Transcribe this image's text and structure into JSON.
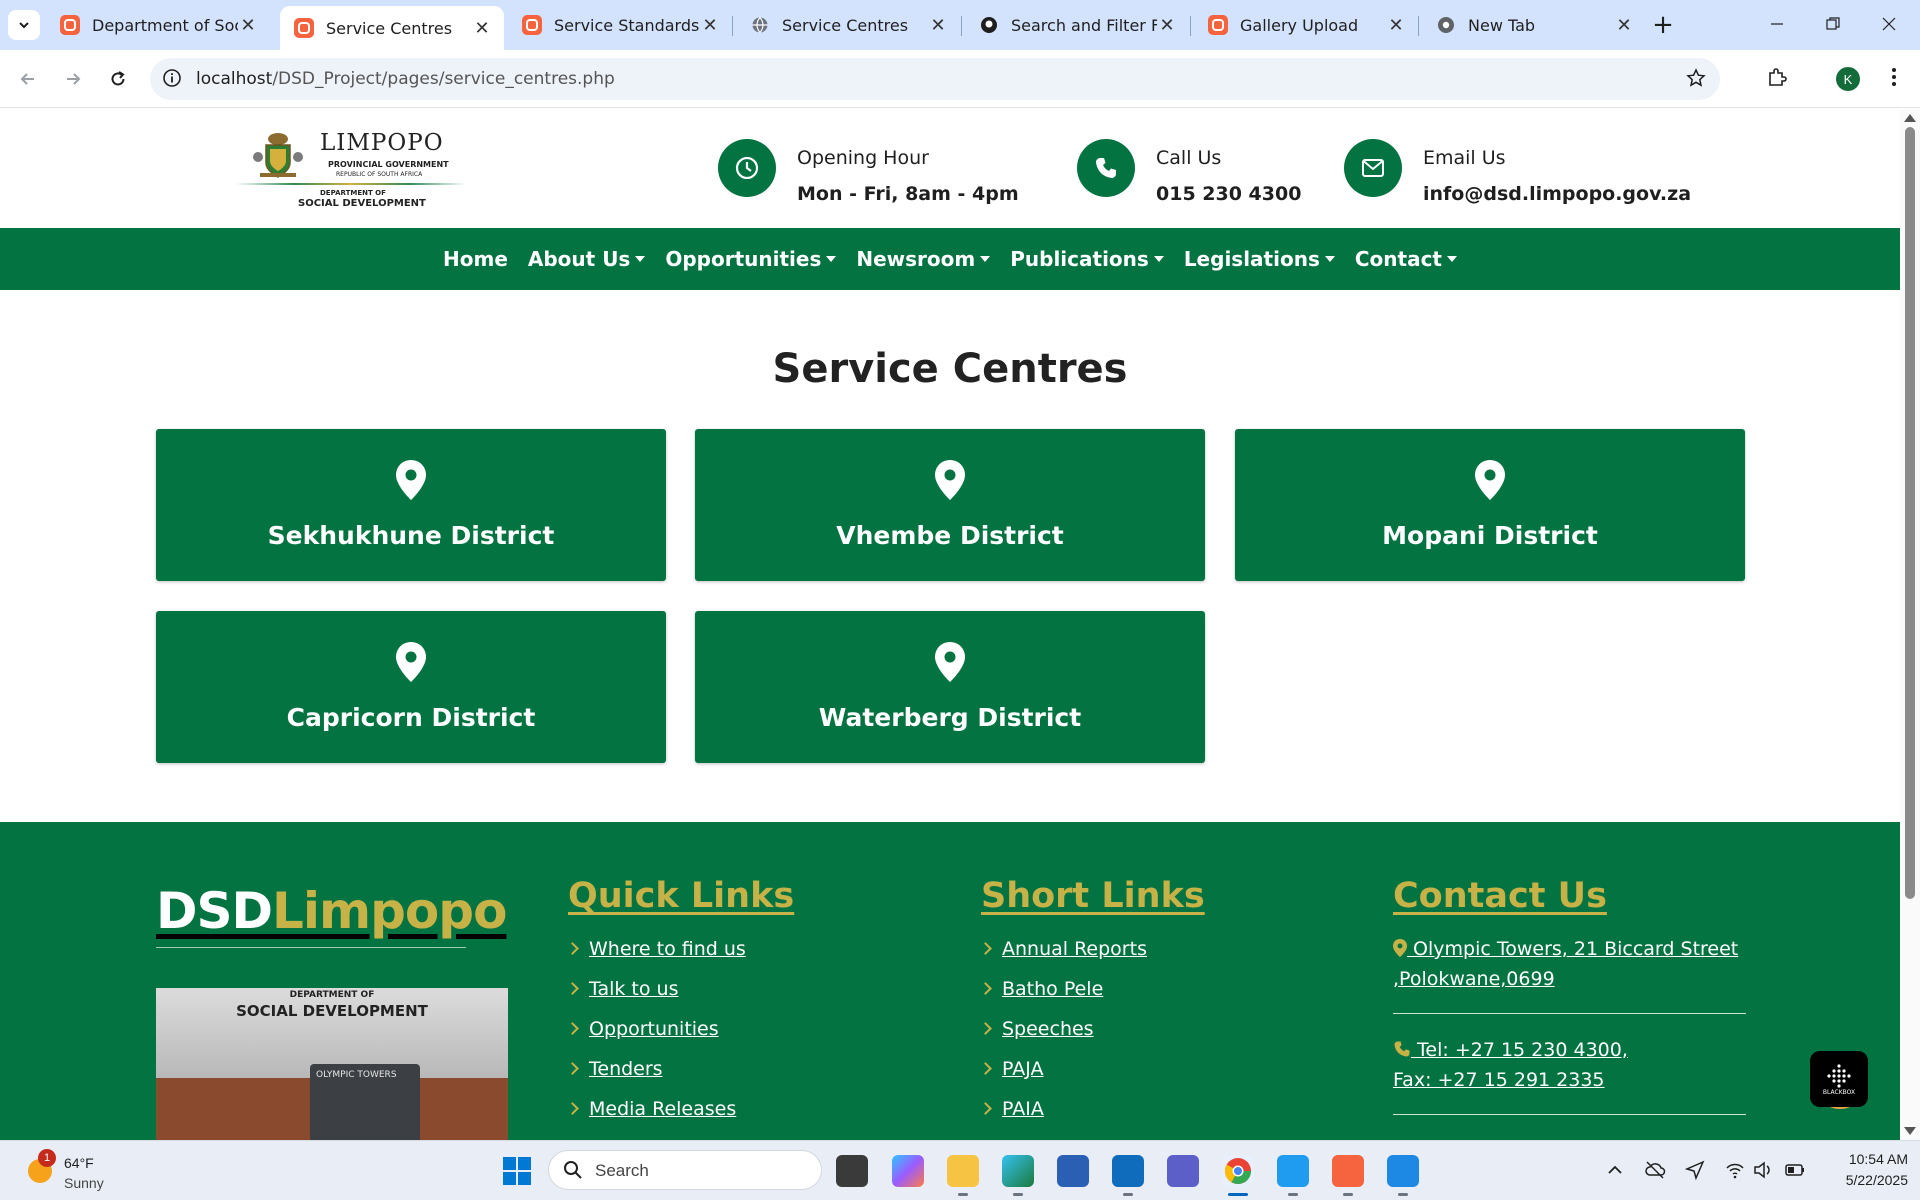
{
  "browser": {
    "tabs": [
      {
        "title": "Department of Social",
        "favicon": "xampp-icon",
        "active": false
      },
      {
        "title": "Service Centres",
        "favicon": "xampp-icon",
        "active": true
      },
      {
        "title": "Service Standards",
        "favicon": "xampp-icon",
        "active": false
      },
      {
        "title": "Service Centres",
        "favicon": "globe-icon",
        "active": false
      },
      {
        "title": "Search and Filter Fun",
        "favicon": "github-icon",
        "active": false
      },
      {
        "title": "Gallery Upload",
        "favicon": "xampp-icon",
        "active": false
      },
      {
        "title": "New Tab",
        "favicon": "chrome-icon",
        "active": false
      }
    ],
    "url_host": "localhost",
    "url_path": "/DSD_Project/pages/service_centres.php",
    "profile_initial": "K"
  },
  "header": {
    "logo": {
      "line1": "LIMPOPO",
      "line2": "PROVINCIAL GOVERNMENT",
      "line3": "REPUBLIC OF SOUTH AFRICA",
      "line4": "DEPARTMENT OF",
      "line5": "SOCIAL DEVELOPMENT"
    },
    "opening": {
      "label": "Opening Hour",
      "value": "Mon - Fri, 8am - 4pm"
    },
    "call": {
      "label": "Call Us",
      "value": "015 230 4300"
    },
    "email": {
      "label": "Email Us",
      "value": "info@dsd.limpopo.gov.za"
    }
  },
  "nav": {
    "home": "Home",
    "about": "About Us",
    "opportunities": "Opportunities",
    "newsroom": "Newsroom",
    "publications": "Publications",
    "legislations": "Legislations",
    "contact": "Contact"
  },
  "main": {
    "title": "Service Centres",
    "districts": [
      "Sekhukhune District",
      "Vhembe District",
      "Mopani District",
      "Capricorn District",
      "Waterberg District"
    ]
  },
  "footer": {
    "brand_a": "DSD",
    "brand_b": "Limpopo",
    "image_text1": "DEPARTMENT OF",
    "image_text2": "SOCIAL DEVELOPMENT",
    "image_text3": "OLYMPIC TOWERS",
    "quick_links": {
      "heading": "Quick Links",
      "items": [
        "Where to find us",
        "Talk to us",
        "Opportunities",
        "Tenders",
        "Media Releases"
      ]
    },
    "short_links": {
      "heading": "Short Links",
      "items": [
        "Annual Reports",
        "Batho Pele",
        "Speeches",
        "PAJA",
        "PAIA"
      ]
    },
    "contact": {
      "heading": "Contact Us",
      "address1": " Olympic Towers, 21 Biccard Street",
      "address2": ",Polokwane,0699",
      "tel": " Tel: +27 15 230 4300,",
      "fax": "Fax: +27 15 291 2335"
    }
  },
  "taskbar": {
    "weather_temp": "64°F",
    "weather_cond": "Sunny",
    "weather_badge": "1",
    "search": "Search",
    "time": "10:54 AM",
    "date": "5/22/2025"
  },
  "widget_label": "BLACKBOX",
  "colors": {
    "brand_green": "#047342",
    "gold": "#c7b247"
  }
}
